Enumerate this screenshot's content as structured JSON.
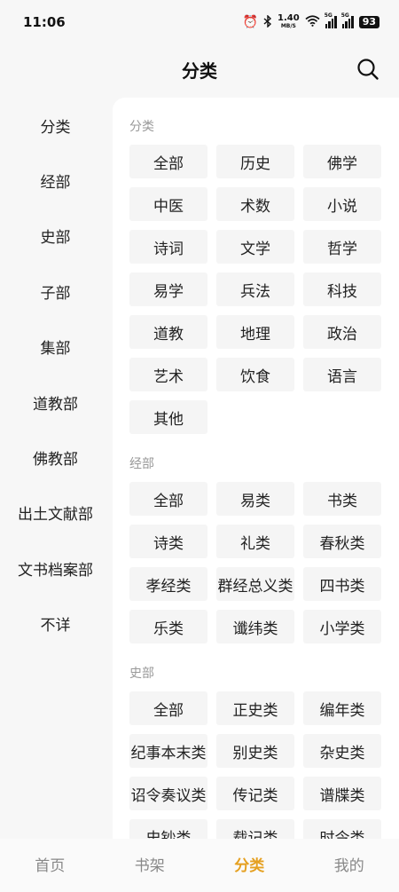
{
  "status_bar": {
    "time": "11:06",
    "speed_value": "1.40",
    "speed_unit": "MB/S",
    "signal1_label": "5G",
    "signal2_label": "5G",
    "battery": "93"
  },
  "header": {
    "title": "分类"
  },
  "sidebar": {
    "items": [
      {
        "label": "分类"
      },
      {
        "label": "经部"
      },
      {
        "label": "史部"
      },
      {
        "label": "子部"
      },
      {
        "label": "集部"
      },
      {
        "label": "道教部"
      },
      {
        "label": "佛教部"
      },
      {
        "label": "出土文献部"
      },
      {
        "label": "文书档案部"
      },
      {
        "label": "不详"
      }
    ]
  },
  "main": {
    "sections": [
      {
        "title": "分类",
        "items": [
          "全部",
          "历史",
          "佛学",
          "中医",
          "术数",
          "小说",
          "诗词",
          "文学",
          "哲学",
          "易学",
          "兵法",
          "科技",
          "道教",
          "地理",
          "政治",
          "艺术",
          "饮食",
          "语言",
          "其他"
        ]
      },
      {
        "title": "经部",
        "items": [
          "全部",
          "易类",
          "书类",
          "诗类",
          "礼类",
          "春秋类",
          "孝经类",
          "群经总义类",
          "四书类",
          "乐类",
          "谶纬类",
          "小学类"
        ]
      },
      {
        "title": "史部",
        "items": [
          "全部",
          "正史类",
          "编年类",
          "纪事本末类",
          "别史类",
          "杂史类",
          "诏令奏议类",
          "传记类",
          "谱牒类",
          "史钞类",
          "载记类",
          "时令类"
        ]
      }
    ]
  },
  "bottom_nav": {
    "items": [
      {
        "label": "首页"
      },
      {
        "label": "书架"
      },
      {
        "label": "分类"
      },
      {
        "label": "我的"
      }
    ],
    "active_color": "#e5a020"
  }
}
